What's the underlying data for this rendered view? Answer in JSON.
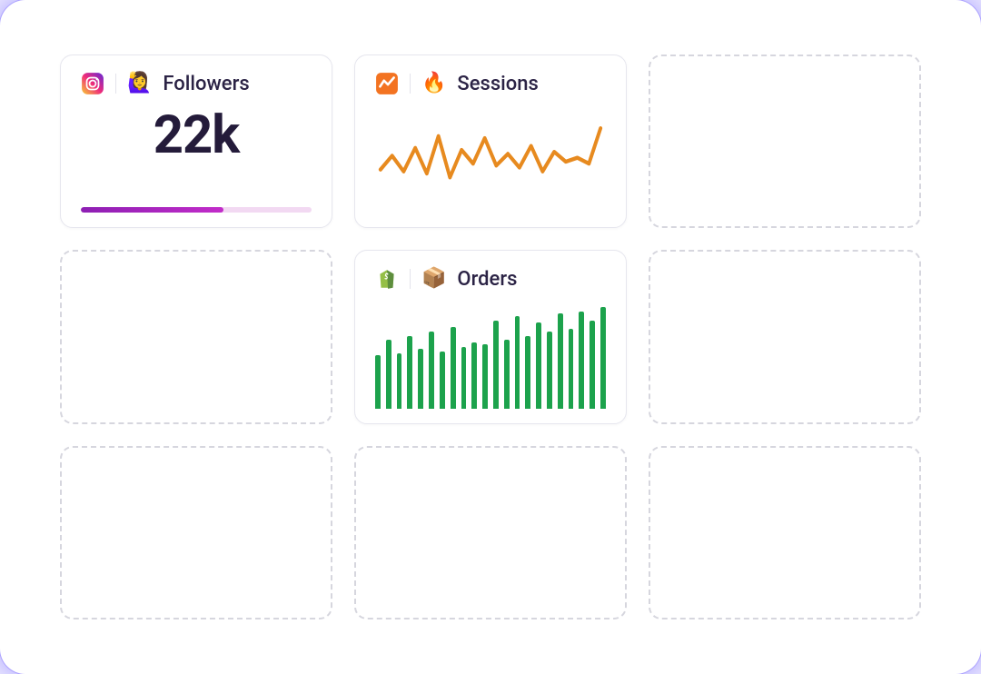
{
  "cards": {
    "followers": {
      "title": "Followers",
      "value": "22k",
      "progress_percent": 62,
      "app_icon": "instagram-icon",
      "emoji": "🙋‍♀️"
    },
    "sessions": {
      "title": "Sessions",
      "app_icon": "analytics-icon",
      "emoji": "🔥"
    },
    "orders": {
      "title": "Orders",
      "app_icon": "shopify-icon",
      "emoji": "📦"
    }
  },
  "chart_data": [
    {
      "type": "line",
      "title": "Sessions",
      "x": [
        0,
        1,
        2,
        3,
        4,
        5,
        6,
        7,
        8,
        9,
        10,
        11,
        12,
        13,
        14,
        15,
        16,
        17,
        18,
        19
      ],
      "values": [
        38,
        52,
        36,
        60,
        34,
        72,
        30,
        58,
        44,
        70,
        42,
        54,
        40,
        62,
        36,
        56,
        46,
        50,
        44,
        80
      ],
      "ylim": [
        0,
        100
      ],
      "color": "#e78a1f"
    },
    {
      "type": "bar",
      "title": "Orders",
      "categories": [
        "1",
        "2",
        "3",
        "4",
        "5",
        "6",
        "7",
        "8",
        "9",
        "10",
        "11",
        "12",
        "13",
        "14",
        "15",
        "16",
        "17",
        "18",
        "19",
        "20",
        "21",
        "22"
      ],
      "values": [
        48,
        62,
        50,
        66,
        54,
        70,
        52,
        74,
        56,
        60,
        58,
        80,
        62,
        84,
        66,
        78,
        70,
        86,
        72,
        88,
        80,
        92
      ],
      "ylim": [
        0,
        100
      ],
      "color": "#1ca24c"
    }
  ],
  "colors": {
    "line": "#e78a1f",
    "bar": "#1ca24c",
    "progress_fill": "#b02ac1",
    "progress_track": "#f2d9f2",
    "glow": "#6d5cff"
  }
}
